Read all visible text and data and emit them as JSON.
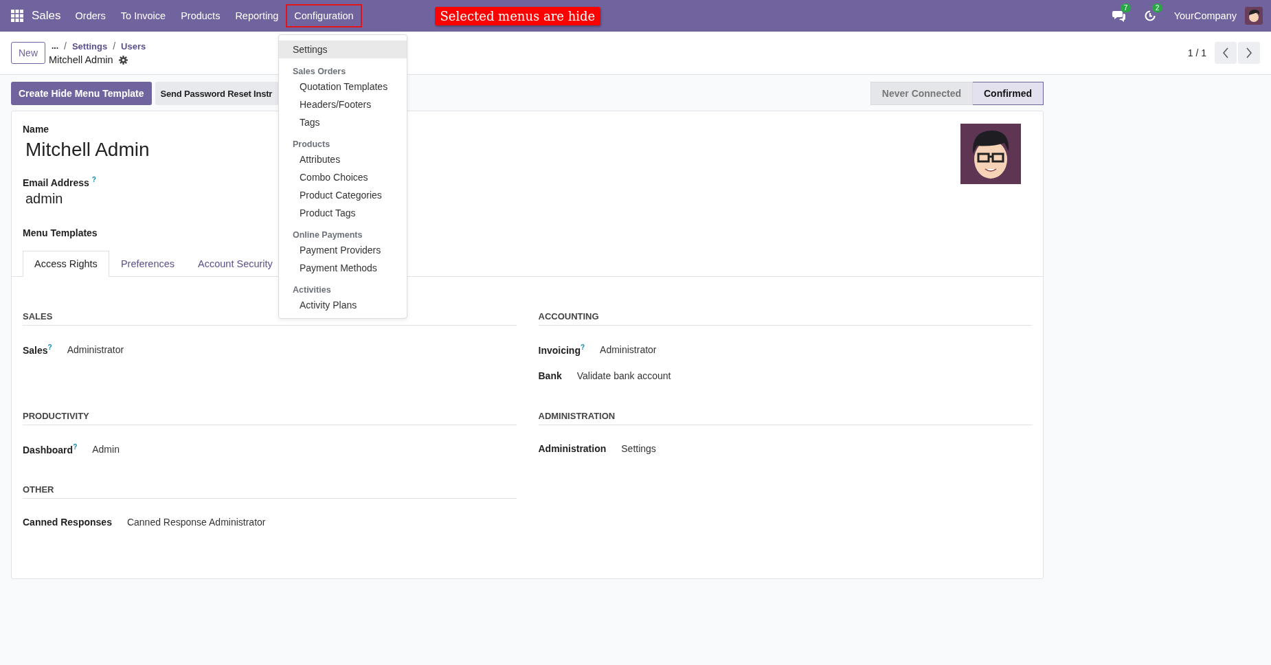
{
  "navbar": {
    "app_name": "Sales",
    "menus": [
      {
        "label": "Orders",
        "selected": false
      },
      {
        "label": "To Invoice",
        "selected": false
      },
      {
        "label": "Products",
        "selected": false
      },
      {
        "label": "Reporting",
        "selected": false
      },
      {
        "label": "Configuration",
        "selected": true
      }
    ],
    "messages_count": "7",
    "activities_count": "2",
    "company": "YourCompany"
  },
  "annotation": "Selected menus are hide",
  "breadcrumb": {
    "more": "...",
    "items": [
      {
        "separator": "/",
        "label": "Settings"
      },
      {
        "separator": "/",
        "label": "Users"
      }
    ],
    "current": "Mitchell Admin"
  },
  "new_button": "New",
  "pager": "1 / 1",
  "actions": [
    "Create Hide Menu Template",
    "Send Password Reset Instr"
  ],
  "statusbar": [
    {
      "label": "Never Connected",
      "selected": false
    },
    {
      "label": "Confirmed",
      "selected": true
    }
  ],
  "form": {
    "name_label": "Name",
    "name": "Mitchell Admin",
    "email_label": "Email Address",
    "email_help": "?",
    "email": "admin",
    "menu_templates_label": "Menu Templates"
  },
  "tabs": [
    {
      "label": "Access Rights",
      "selected": true
    },
    {
      "label": "Preferences",
      "selected": false
    },
    {
      "label": "Account Security",
      "selected": false
    }
  ],
  "columns": [
    [
      {
        "title": "SALES",
        "fields": [
          {
            "label": "Sales",
            "help": "?",
            "value": "Administrator"
          }
        ]
      },
      {
        "title": "PRODUCTIVITY",
        "fields": [
          {
            "label": "Dashboard",
            "help": "?",
            "value": "Admin"
          }
        ]
      },
      {
        "title": "OTHER",
        "fields": [
          {
            "label": "Canned Responses",
            "value": "Canned Response Administrator"
          }
        ]
      }
    ],
    [
      {
        "title": "ACCOUNTING",
        "fields": [
          {
            "label": "Invoicing",
            "help": "?",
            "value": "Administrator"
          },
          {
            "label": "Bank",
            "value": "Validate bank account"
          }
        ]
      },
      {
        "title": "ADMINISTRATION",
        "fields": [
          {
            "label": "Administration",
            "value": "Settings"
          }
        ]
      }
    ]
  ],
  "dropdown": [
    {
      "kind": "item",
      "label": "Settings",
      "selected": true
    },
    {
      "kind": "header",
      "label": "Sales Orders"
    },
    {
      "kind": "subitem",
      "label": "Quotation Templates",
      "selected": false
    },
    {
      "kind": "subitem",
      "label": "Headers/Footers",
      "selected": false
    },
    {
      "kind": "subitem",
      "label": "Tags",
      "selected": false
    },
    {
      "kind": "header",
      "label": "Products"
    },
    {
      "kind": "subitem",
      "label": "Attributes",
      "selected": false
    },
    {
      "kind": "subitem",
      "label": "Combo Choices",
      "selected": false
    },
    {
      "kind": "subitem",
      "label": "Product Categories",
      "selected": false
    },
    {
      "kind": "subitem",
      "label": "Product Tags",
      "selected": false
    },
    {
      "kind": "header",
      "label": "Online Payments"
    },
    {
      "kind": "subitem",
      "label": "Payment Providers",
      "selected": false
    },
    {
      "kind": "subitem",
      "label": "Payment Methods",
      "selected": false
    },
    {
      "kind": "header",
      "label": "Activities"
    },
    {
      "kind": "subitem",
      "label": "Activity Plans",
      "selected": false
    }
  ]
}
